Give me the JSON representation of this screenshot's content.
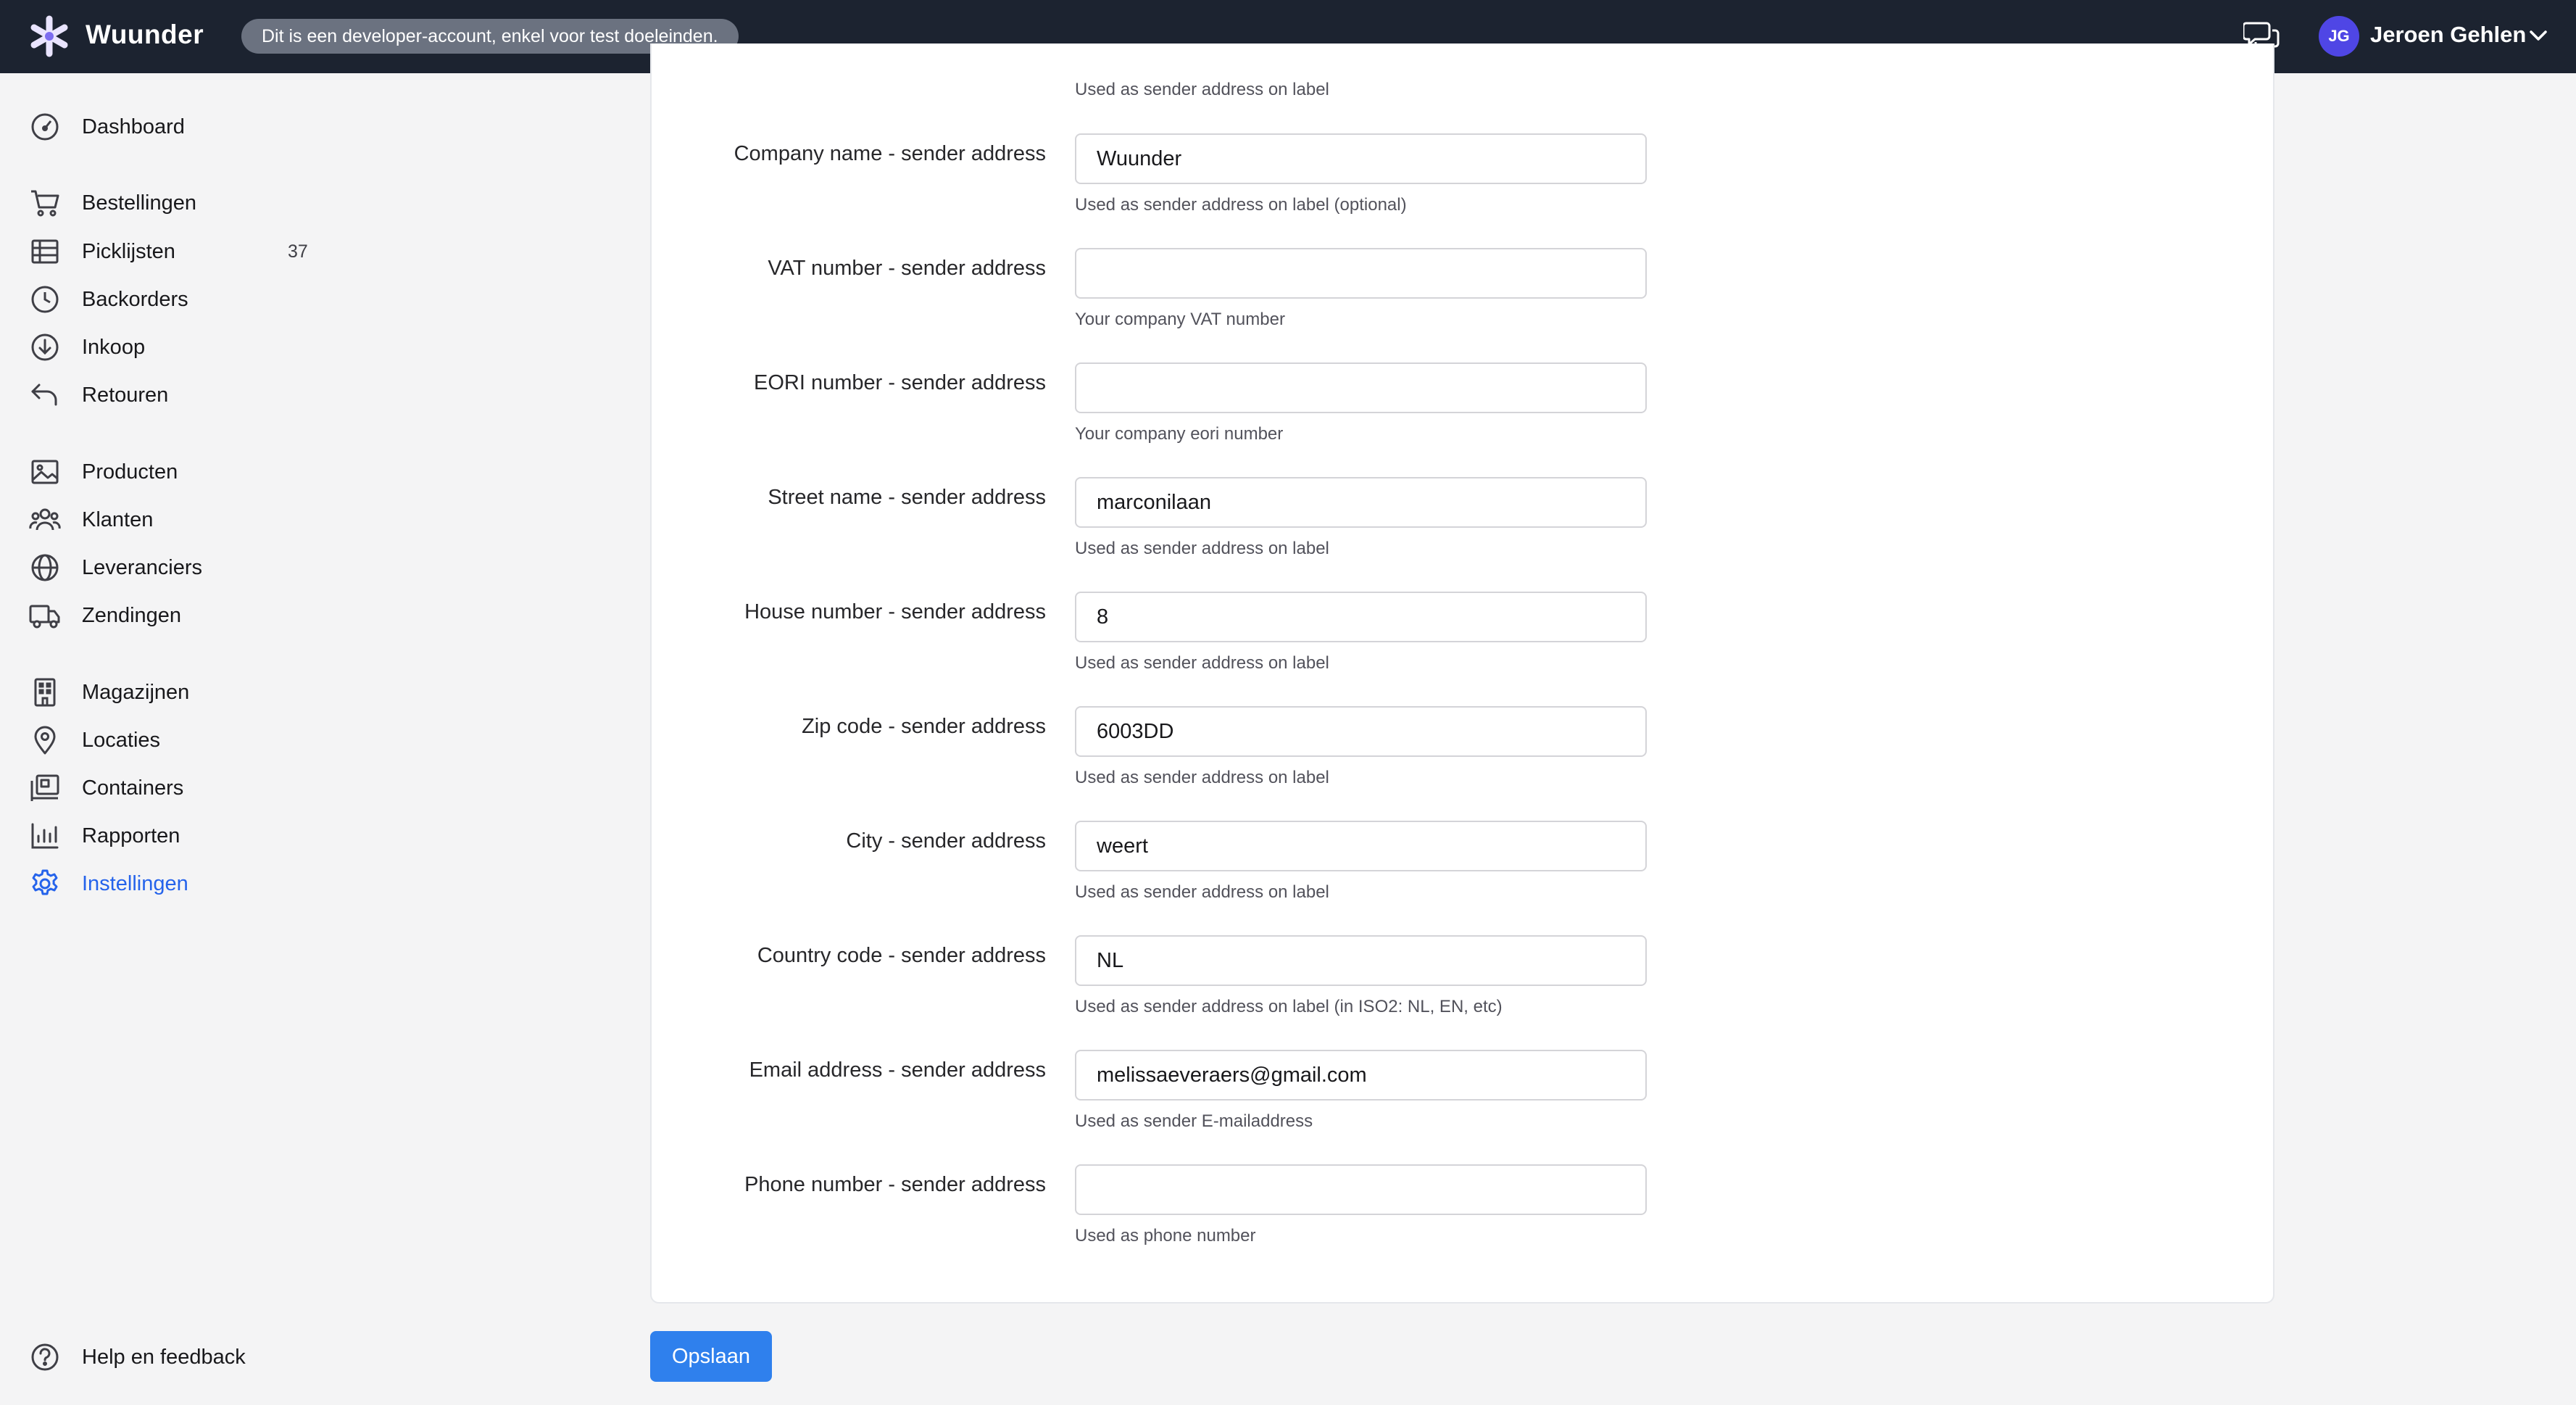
{
  "app": {
    "title": "Wuunder",
    "dev_badge": "Dit is een developer-account, enkel voor test doeleinden.",
    "accent": "#2563eb"
  },
  "user": {
    "initials": "JG",
    "name": "Jeroen Gehlen"
  },
  "sidebar": {
    "items": [
      {
        "label": "Dashboard",
        "icon": "dashboard-gauge-icon"
      },
      {
        "label": "Bestellingen",
        "icon": "shopping-cart-icon"
      },
      {
        "label": "Picklijsten",
        "icon": "table-list-icon",
        "count": "37"
      },
      {
        "label": "Backorders",
        "icon": "clock-icon"
      },
      {
        "label": "Inkoop",
        "icon": "download-circle-icon"
      },
      {
        "label": "Retouren",
        "icon": "return-arrow-icon"
      },
      {
        "label": "Producten",
        "icon": "image-icon"
      },
      {
        "label": "Klanten",
        "icon": "users-icon"
      },
      {
        "label": "Leveranciers",
        "icon": "globe-icon"
      },
      {
        "label": "Zendingen",
        "icon": "truck-icon"
      },
      {
        "label": "Magazijnen",
        "icon": "building-icon"
      },
      {
        "label": "Locaties",
        "icon": "map-pin-icon"
      },
      {
        "label": "Containers",
        "icon": "container-icon"
      },
      {
        "label": "Rapporten",
        "icon": "bar-chart-icon"
      },
      {
        "label": "Instellingen",
        "icon": "gear-icon",
        "active": true
      }
    ],
    "help": {
      "label": "Help en feedback",
      "icon": "question-circle-icon"
    }
  },
  "form": {
    "top_help": "Used as sender address on label",
    "fields": [
      {
        "label": "Company name - sender address",
        "value": "Wuunder",
        "help": "Used as sender address on label (optional)"
      },
      {
        "label": "VAT number - sender address",
        "value": "",
        "help": "Your company VAT number"
      },
      {
        "label": "EORI number - sender address",
        "value": "",
        "help": "Your company eori number"
      },
      {
        "label": "Street name - sender address",
        "value": "marconilaan",
        "help": "Used as sender address on label"
      },
      {
        "label": "House number - sender address",
        "value": "8",
        "help": "Used as sender address on label"
      },
      {
        "label": "Zip code - sender address",
        "value": "6003DD",
        "help": "Used as sender address on label"
      },
      {
        "label": "City - sender address",
        "value": "weert",
        "help": "Used as sender address on label"
      },
      {
        "label": "Country code - sender address",
        "value": "NL",
        "help": "Used as sender address on label (in ISO2: NL, EN, etc)"
      },
      {
        "label": "Email address - sender address",
        "value": "melissaeveraers@gmail.com",
        "help": "Used as sender E-mailaddress"
      },
      {
        "label": "Phone number - sender address",
        "value": "",
        "help": "Used as phone number"
      }
    ],
    "save_label": "Opslaan"
  }
}
